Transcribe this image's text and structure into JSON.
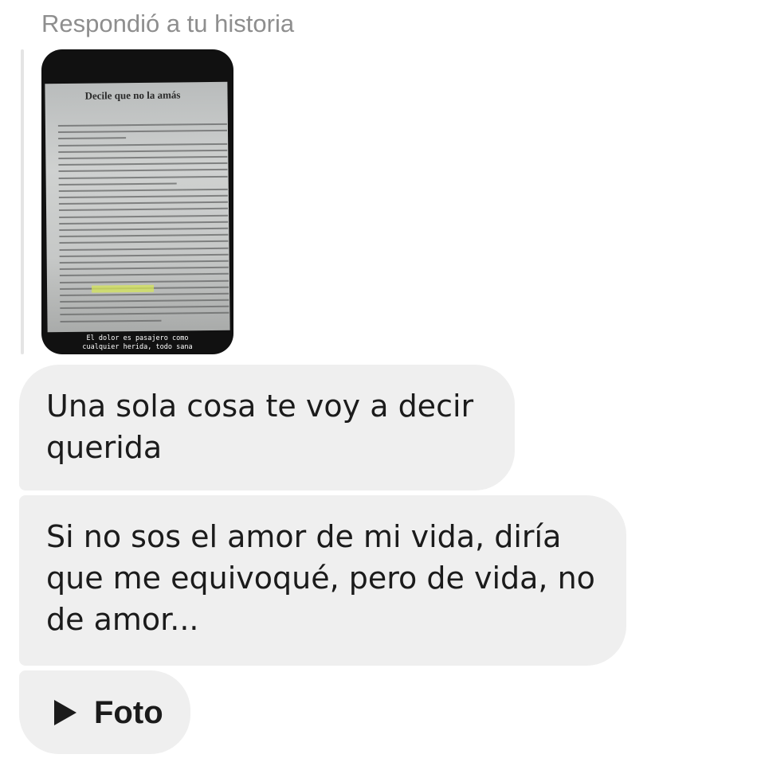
{
  "header": {
    "reply_label": "Respondió a tu historia"
  },
  "story": {
    "page_title": "Decile que no la amás",
    "caption": "El dolor es pasajero como\ncualquier herida, todo sana"
  },
  "messages": [
    {
      "text": "Una sola cosa te voy a decir querida"
    },
    {
      "text": "Si no sos el amor de mi vida, diría que me equivoqué, pero de vida, no de amor..."
    }
  ],
  "attachment": {
    "label": "Foto",
    "icon": "play-icon"
  },
  "colors": {
    "bubble": "#efefef",
    "header_text": "#8e8e8e",
    "text": "#1b1b1b"
  }
}
